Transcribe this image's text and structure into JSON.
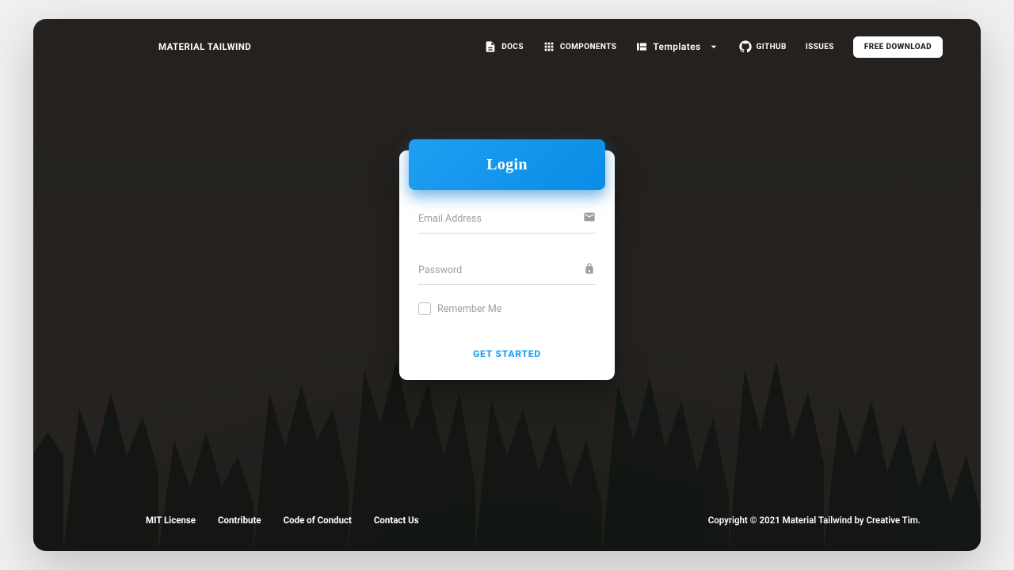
{
  "nav": {
    "brand": "MATERIAL TAILWIND",
    "docs": "DOCS",
    "components": "COMPONENTS",
    "templates": "Templates",
    "github": "GITHUB",
    "issues": "ISSUES",
    "download": "FREE DOWNLOAD"
  },
  "card": {
    "title": "Login",
    "email_label": "Email Address",
    "password_label": "Password",
    "remember_label": "Remember Me",
    "submit": "GET STARTED"
  },
  "footer": {
    "links": {
      "license": "MIT License",
      "contribute": "Contribute",
      "conduct": "Code of Conduct",
      "contact": "Contact Us"
    },
    "copyright": "Copyright © 2021 Material Tailwind by Creative Tim."
  },
  "colors": {
    "accent": "#1e9ff2"
  }
}
